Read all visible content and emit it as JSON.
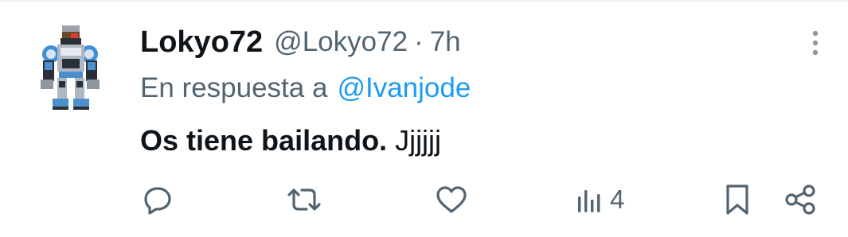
{
  "tweet": {
    "display_name": "Lokyo72",
    "handle": "@Lokyo72",
    "separator": "·",
    "time": "7h",
    "reply_prefix": "En respuesta a",
    "reply_to": "@Ivanjode",
    "text_bold": "Os tiene bailando.",
    "text_rest": " Jjjjjj"
  },
  "actions": {
    "views_count": "4"
  },
  "icons": {
    "reply": "comment-bubble-icon",
    "retweet": "retweet-icon",
    "like": "heart-icon",
    "views": "bar-chart-icon",
    "bookmark": "bookmark-icon",
    "share": "share-icon",
    "more": "more-vertical-icon"
  },
  "colors": {
    "text_primary": "#0f1419",
    "text_secondary": "#536471",
    "link": "#1d9bf0",
    "divider": "#eff3f4"
  }
}
